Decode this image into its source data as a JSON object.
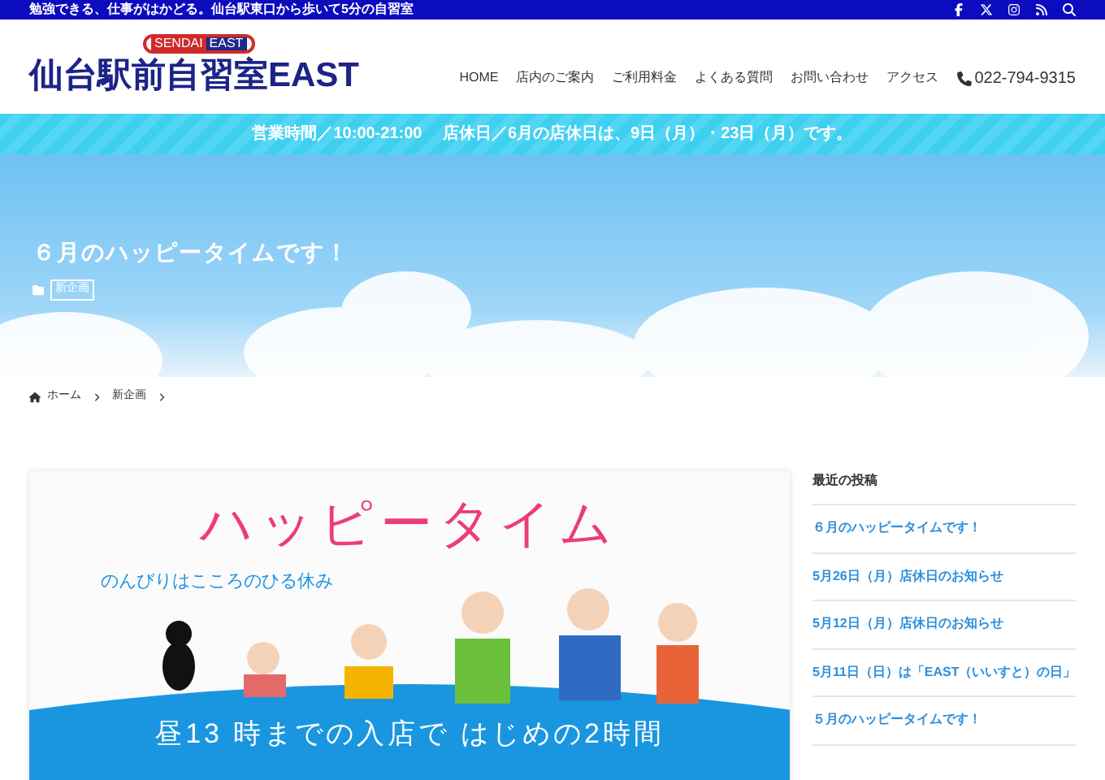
{
  "topbar": {
    "tagline": "勉強できる、仕事がはかどる。仙台駅東口から歩いて5分の自習室"
  },
  "header": {
    "logo_badge": [
      "SENDAI",
      "EAST"
    ],
    "logo_text": "仙台駅前自習室EAST",
    "nav": [
      {
        "label": "HOME"
      },
      {
        "label": "店内のご案内"
      },
      {
        "label": "ご利用料金"
      },
      {
        "label": "よくある質問"
      },
      {
        "label": "お問い合わせ"
      },
      {
        "label": "アクセス"
      }
    ],
    "phone": "022-794-9315"
  },
  "notice": "営業時間／10:00-21:00　 店休日／6月の店休日は、9日（月）・23日（月）です。",
  "hero": {
    "title": "６月のハッピータイムです！",
    "category": "新企画"
  },
  "breadcrumb": [
    "ホーム",
    "新企画"
  ],
  "featured_image": {
    "title": "ハッピータイム",
    "subtitle": "のんびりはこころのひる休み",
    "caption": "昼13 時までの入店で はじめの2時間"
  },
  "sidebar": {
    "heading": "最近の投稿",
    "posts": [
      "６月のハッピータイムです！",
      "5月26日（月）店休日のお知らせ",
      "5月12日（月）店休日のお知らせ",
      "5月11日（日）は「EAST（いいすと）の日」",
      "５月のハッピータイムです！"
    ]
  }
}
